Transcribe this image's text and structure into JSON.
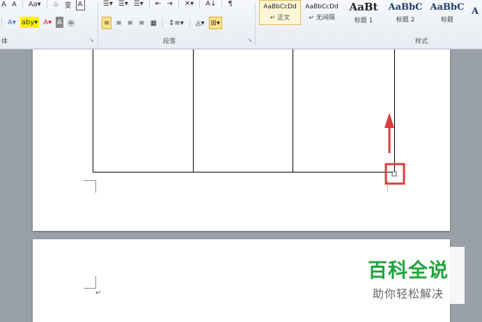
{
  "ribbon": {
    "font_row1": [
      "A",
      "A",
      "Aa▾",
      "♨",
      "变",
      "A"
    ],
    "font_row2": [
      "A▾",
      "aby▾",
      "A▾",
      "A",
      "㊥"
    ],
    "para_row1": [
      "☰▾",
      "☰▾",
      "☰▾",
      "⇤",
      "⇥",
      "✕▾",
      "A↓",
      "¶"
    ],
    "para_row2": [
      "≡",
      "≡",
      "≡",
      "≡",
      "▦",
      "↕≡▾",
      "◬▾",
      "⊞▾"
    ],
    "group_labels": {
      "font_partial": "体",
      "paragraph": "段落",
      "styles": "样式"
    },
    "styles": [
      {
        "sample": "AaBbCcDd",
        "name": "↵ 正文",
        "selected": true,
        "kind": "small"
      },
      {
        "sample": "AaBbCcDd",
        "name": "↵ 无间隔",
        "selected": false,
        "kind": "small"
      },
      {
        "sample": "AaBt",
        "name": "标题 1",
        "selected": false,
        "kind": "big"
      },
      {
        "sample": "AaBbC",
        "name": "标题 2",
        "selected": false,
        "kind": "mid"
      },
      {
        "sample": "AaBbC",
        "name": "标题",
        "selected": false,
        "kind": "mid"
      },
      {
        "sample": "A",
        "name": "",
        "selected": false,
        "kind": "mid"
      }
    ]
  },
  "document": {
    "paragraph_mark": "↵",
    "annotation_color": "#e0383b"
  },
  "watermark": {
    "title": "百科全说",
    "subtitle": "助你轻松解决",
    "color": "#1fa33a"
  }
}
